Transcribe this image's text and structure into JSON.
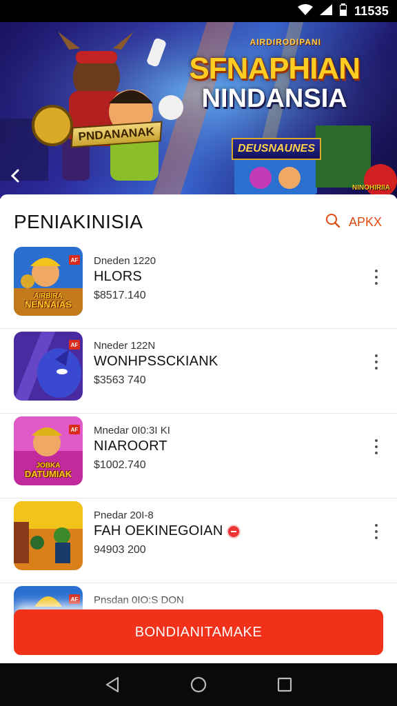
{
  "status_bar": {
    "time": "11535",
    "icons": [
      "wifi-icon",
      "signal-icon",
      "battery-icon"
    ]
  },
  "hero": {
    "kicker": "AIRDIRODIPANI",
    "title_line1": "SFNAPHIAN",
    "title_line2": "NINDANSIA",
    "ribbon": "PNDANANAK",
    "sub_label": "DEUSNAUNES",
    "corner_text": "NINOHIRIIA",
    "back_icon": "chevron-left-icon"
  },
  "header": {
    "title": "PENIAKINISIA",
    "search_icon": "search-icon",
    "action_label": "APKX",
    "accent": "#e04a10"
  },
  "items": [
    {
      "meta": "Dneden 1220",
      "name": "HLORS",
      "price": "$8517.140",
      "thumb_caption": "NENNAIAS",
      "thumb_pre": "AIRBIRA",
      "badge": "AF"
    },
    {
      "meta": "Nneder 122N",
      "name": "WONHPSSCKIANK",
      "price": "$3563 740",
      "thumb_caption": "",
      "thumb_pre": "",
      "badge": "AF"
    },
    {
      "meta": "Mnedar 0I0:3I KI",
      "name": "NIAROORT",
      "price": "$1002.740",
      "thumb_caption": "DATUMIAK",
      "thumb_pre": "JOBKA",
      "badge": "AF"
    },
    {
      "meta": "Pnedar 20I-8",
      "name": "FAH OEKINEGOIAN",
      "price": "94903 200",
      "thumb_caption": "",
      "thumb_pre": "",
      "badge": ""
    },
    {
      "meta": "Pnsdan 0IO:S DON",
      "name": "",
      "price": "",
      "thumb_caption": "",
      "thumb_pre": "",
      "badge": "AF"
    }
  ],
  "cta": {
    "label": "BONDIANITAMAKE",
    "color": "#f2311a"
  },
  "nav": {
    "back": "back-triangle-icon",
    "home": "home-circle-icon",
    "recents": "recents-square-icon"
  }
}
